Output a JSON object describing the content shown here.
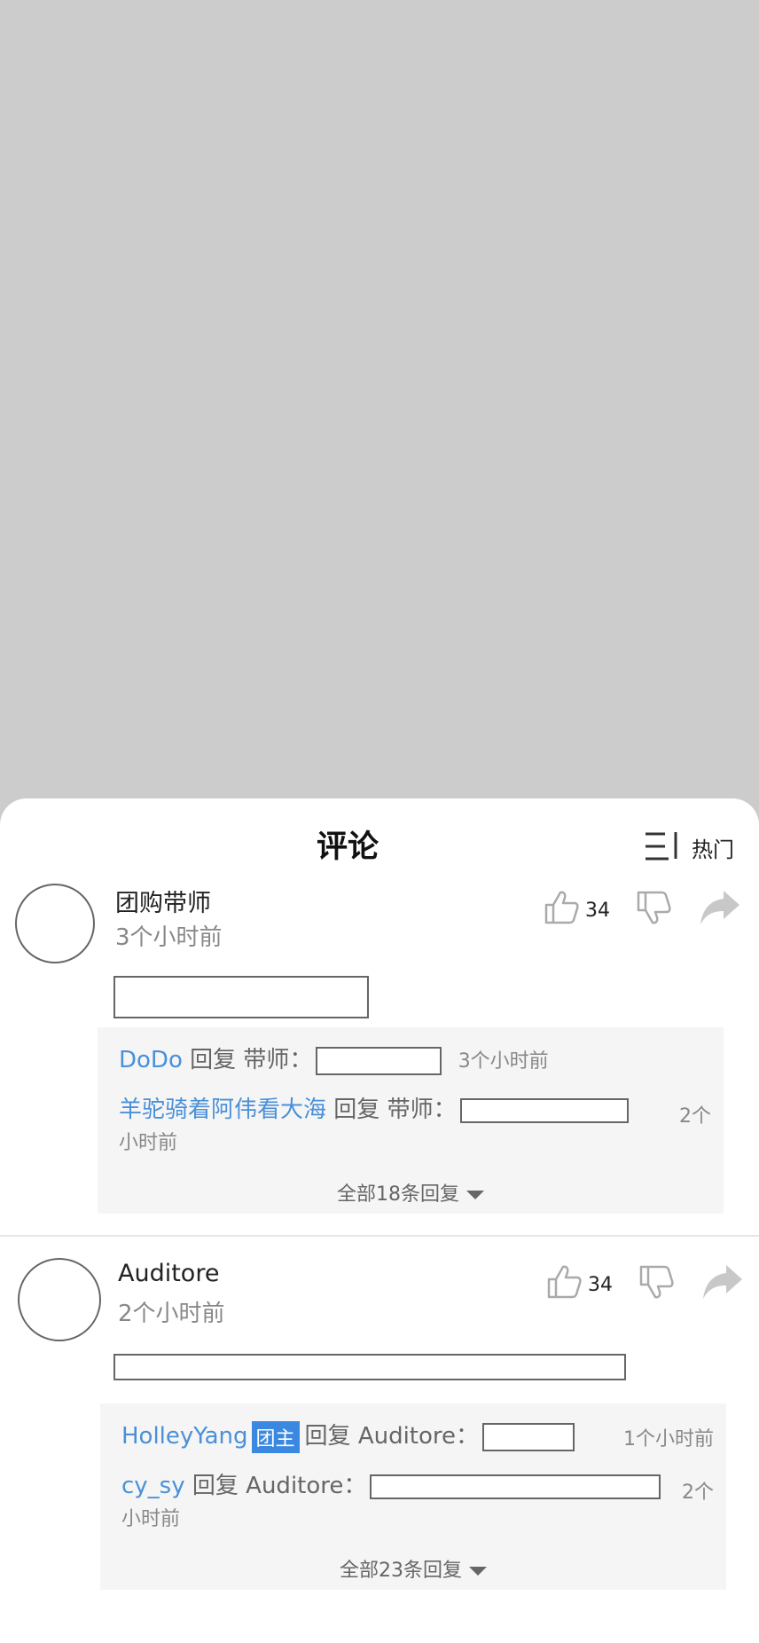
{
  "sheet": {
    "title": "评论",
    "sort_label": "热门"
  },
  "comments": [
    {
      "author": "团购带师",
      "time": "3个小时前",
      "likes": "34",
      "replies": [
        {
          "user": "DoDo",
          "action": "回复",
          "target": "带师：",
          "time": "3个小时前"
        },
        {
          "user": "羊驼骑着阿伟看大海",
          "action": "回复",
          "target": "带师：",
          "time_a": "2个",
          "time_b": "小时前"
        }
      ],
      "more": "全部18条回复"
    },
    {
      "author": "Auditore",
      "time": "2个小时前",
      "likes": "34",
      "replies": [
        {
          "user": "HolleyYang",
          "badge": "团主",
          "action": "回复",
          "target": "Auditore：",
          "time": "1个小时前"
        },
        {
          "user": "cy_sy",
          "action": "回复",
          "target": "Auditore：",
          "time_a": "2个",
          "time_b": "小时前"
        }
      ],
      "more": "全部23条回复"
    }
  ]
}
